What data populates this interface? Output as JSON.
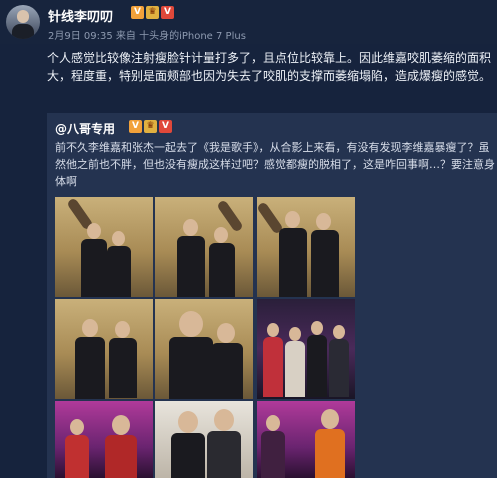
{
  "post": {
    "username": "针线李叨叨",
    "meta": "2月9日 09:35 来自 十头身的iPhone 7 Plus",
    "text": "个人感觉比较像注射瘦脸针计量打多了，且点位比较靠上。因此维嘉咬肌萎缩的面积大，程度重，特别是面颊部也因为失去了咬肌的支撑而萎缩塌陷，造成爆瘦的感觉。"
  },
  "repost": {
    "username": "@八哥专用",
    "text": "前不久李维嘉和张杰一起去了《我是歌手》，从合影上来看，有没有发现李维嘉暴瘦了？虽然他之前也不胖，但也没有瘦成这样过吧？感觉都瘦的脱相了，这是咋回事啊…？要注意身体啊"
  },
  "badges": {
    "v": "V",
    "crown": "♛",
    "vip": "V"
  },
  "photos": [
    "photo-1",
    "photo-2",
    "photo-3",
    "photo-4",
    "photo-5",
    "photo-6",
    "photo-7",
    "photo-8",
    "photo-9"
  ],
  "colors": {
    "background": "#16233d",
    "repost_bg": "#243350",
    "badge_orange": "#f2a13a",
    "badge_red": "#e0483a"
  }
}
